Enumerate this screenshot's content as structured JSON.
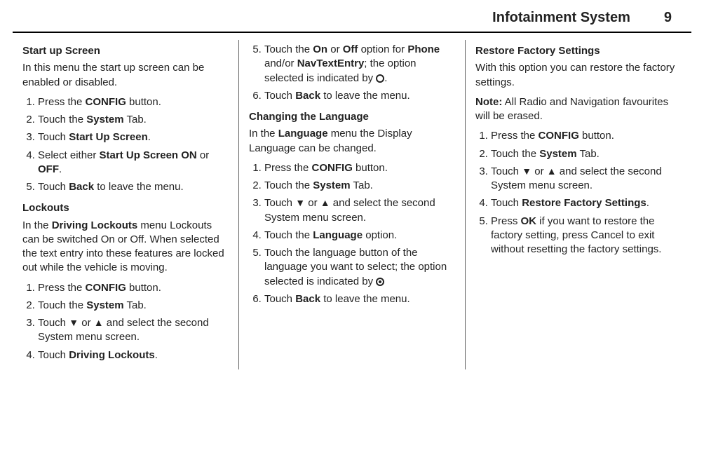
{
  "header": {
    "title": "Infotainment System",
    "page": "9"
  },
  "col1": {
    "startup": {
      "heading": "Start up Screen",
      "intro": "In this menu the start up screen can be enabled or disabled.",
      "steps": [
        "Press the <b>CONFIG</b> button.",
        "Touch the <b>System</b> Tab.",
        "Touch <b>Start Up Screen</b>.",
        "Select either <b>Start Up Screen ON</b> or <b>OFF</b>.",
        "Touch <b>Back</b> to leave the menu."
      ]
    },
    "lockouts": {
      "heading": "Lockouts",
      "intro": "In the <b>Driving Lockouts</b> menu Lockouts can be switched On or Off. When selected the text entry into these features are locked out while the vehicle is moving.",
      "steps": [
        "Press the <b>CONFIG</b> button.",
        "Touch the <b>System</b> Tab.",
        "Touch <span class='arr'>▼</span> or <span class='arr'>▲</span> and select the second System menu screen.",
        "Touch <b>Driving Lockouts</b>."
      ]
    }
  },
  "col2": {
    "lockouts_cont": {
      "start": 5,
      "steps": [
        "Touch the <b>On</b> or <b>Off</b> option for <b>Phone</b> and/or <b>NavTextEntry</b>; the option selected is indicated by <span class='circ'></span>.",
        "Touch <b>Back</b> to leave the menu."
      ]
    },
    "language": {
      "heading": "Changing the Language",
      "intro": "In the <b>Language</b> menu the Display Language can be changed.",
      "steps": [
        "Press the <b>CONFIG</b> button.",
        "Touch the <b>System</b> Tab.",
        "Touch <span class='arr'>▼</span> or <span class='arr'>▲</span> and select the second System menu screen.",
        "Touch the <b>Language</b> option.",
        "Touch the language button of the language you want to select; the option selected is indicated by <span class='circ dot'></span>",
        "Touch <b>Back</b> to leave the menu."
      ]
    }
  },
  "col3": {
    "restore": {
      "heading": "Restore Factory Settings",
      "intro": "With this option you can restore the factory settings.",
      "note": "<b>Note:</b> All Radio and Navigation favourites will be erased.",
      "steps": [
        "Press the <b>CONFIG</b> button.",
        "Touch the <b>System</b> Tab.",
        "Touch <span class='arr'>▼</span> or <span class='arr'>▲</span> and select the second System menu screen.",
        "Touch <b>Restore Factory Settings</b>.",
        "Press <b>OK</b> if you want to restore the factory setting, press Cancel to exit without resetting the factory settings."
      ]
    }
  }
}
